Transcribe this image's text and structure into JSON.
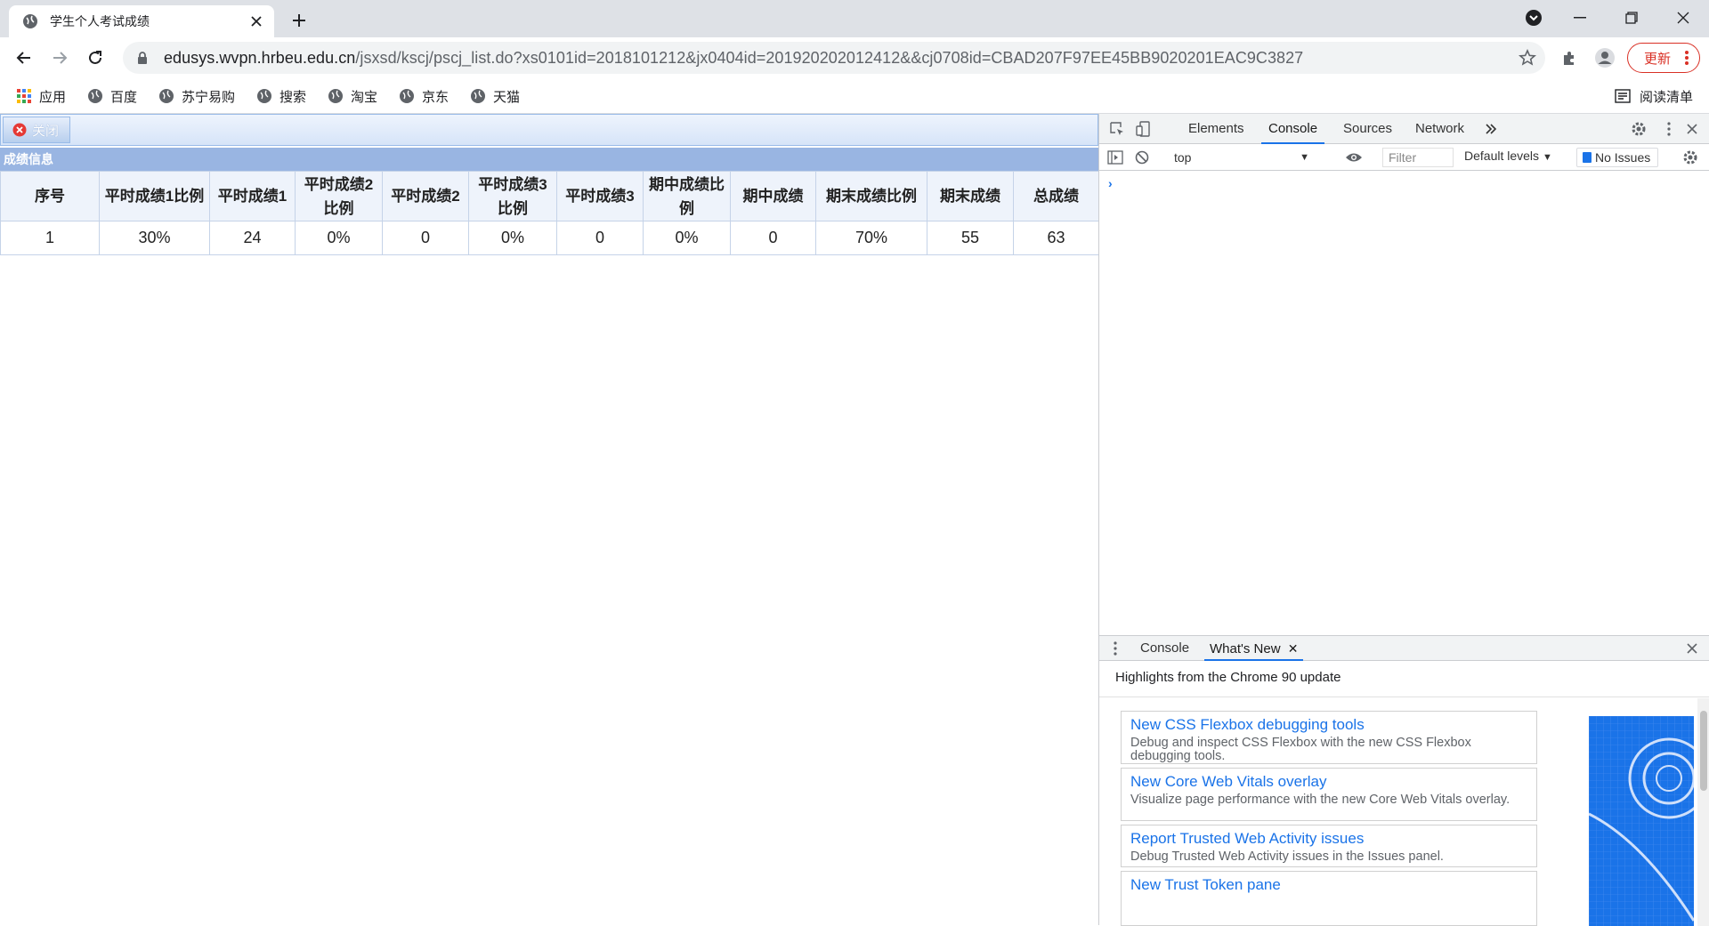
{
  "browser": {
    "tab_title": "学生个人考试成绩",
    "url_host": "edusys.wvpn.hrbeu.edu.cn",
    "url_path": "/jsxsd/kscj/pscj_list.do?xs0101id=2018101212&jx0404id=201920202012412&&cj0708id=CBAD207F97EE45BB9020201EAC9C3827",
    "update_label": "更新",
    "bookmarks": [
      "应用",
      "百度",
      "苏宁易购",
      "搜索",
      "淘宝",
      "京东",
      "天猫"
    ],
    "reading_list": "阅读清单"
  },
  "page": {
    "close_label": "关闭",
    "section_title": "成绩信息",
    "columns": [
      "序号",
      "平时成绩1比例",
      "平时成绩1",
      "平时成绩2比例",
      "平时成绩2",
      "平时成绩3比例",
      "平时成绩3",
      "期中成绩比例",
      "期中成绩",
      "期末成绩比例",
      "期末成绩",
      "总成绩"
    ],
    "rows": [
      [
        "1",
        "30%",
        "24",
        "0%",
        "0",
        "0%",
        "0",
        "0%",
        "0",
        "70%",
        "55",
        "63"
      ]
    ]
  },
  "devtools": {
    "tabs": [
      "Elements",
      "Console",
      "Sources",
      "Network"
    ],
    "active_tab": "Console",
    "context": "top",
    "filter_placeholder": "Filter",
    "levels": "Default levels",
    "issues": "No Issues",
    "drawer_tabs": [
      "Console",
      "What's New"
    ],
    "highlights": "Highlights from the Chrome 90 update",
    "whats_new": [
      {
        "title": "New CSS Flexbox debugging tools",
        "desc": "Debug and inspect CSS Flexbox with the new CSS Flexbox debugging tools."
      },
      {
        "title": "New Core Web Vitals overlay",
        "desc": "Visualize page performance with the new Core Web Vitals overlay."
      },
      {
        "title": "Report Trusted Web Activity issues",
        "desc": "Debug Trusted Web Activity issues in the Issues panel."
      },
      {
        "title": "New Trust Token pane",
        "desc": ""
      }
    ]
  },
  "colors": {
    "accent": "#1a73e8",
    "update_red": "#d93025",
    "section_header": "#99b5e2"
  }
}
